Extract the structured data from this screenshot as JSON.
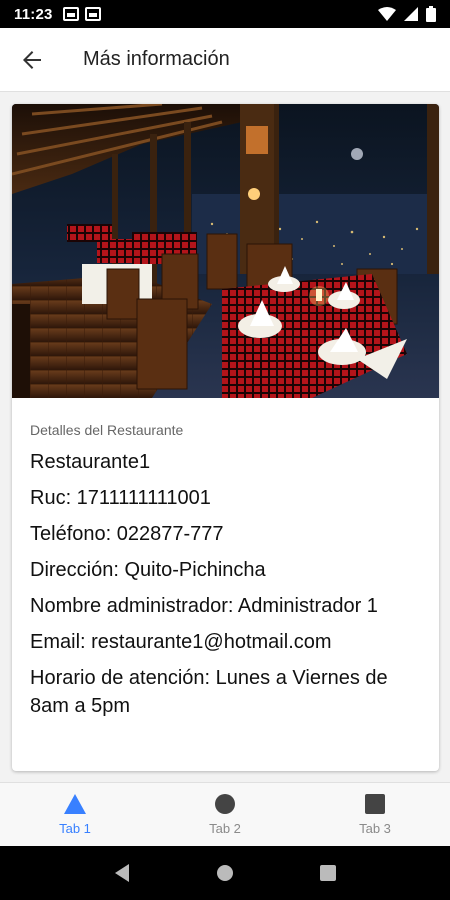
{
  "status_bar": {
    "time": "11:23"
  },
  "app_bar": {
    "title": "Más información"
  },
  "card": {
    "caption": "Detalles del Restaurante",
    "lines": [
      "Restaurante1",
      "Ruc: 1711111111001",
      "Teléfono: 022877-777",
      "Dirección: Quito-Pichincha",
      "Nombre administrador: Administrador 1",
      "Email: restaurante1@hotmail.com",
      "Horario de atención: Lunes a Viernes de 8am a 5pm"
    ]
  },
  "tabs": [
    {
      "label": "Tab 1",
      "icon": "triangle-icon",
      "active": true
    },
    {
      "label": "Tab 2",
      "icon": "circle-icon",
      "active": false
    },
    {
      "label": "Tab 3",
      "icon": "square-icon",
      "active": false
    }
  ],
  "colors": {
    "accent": "#3880ff",
    "tab_inactive": "#8a8a8a"
  }
}
